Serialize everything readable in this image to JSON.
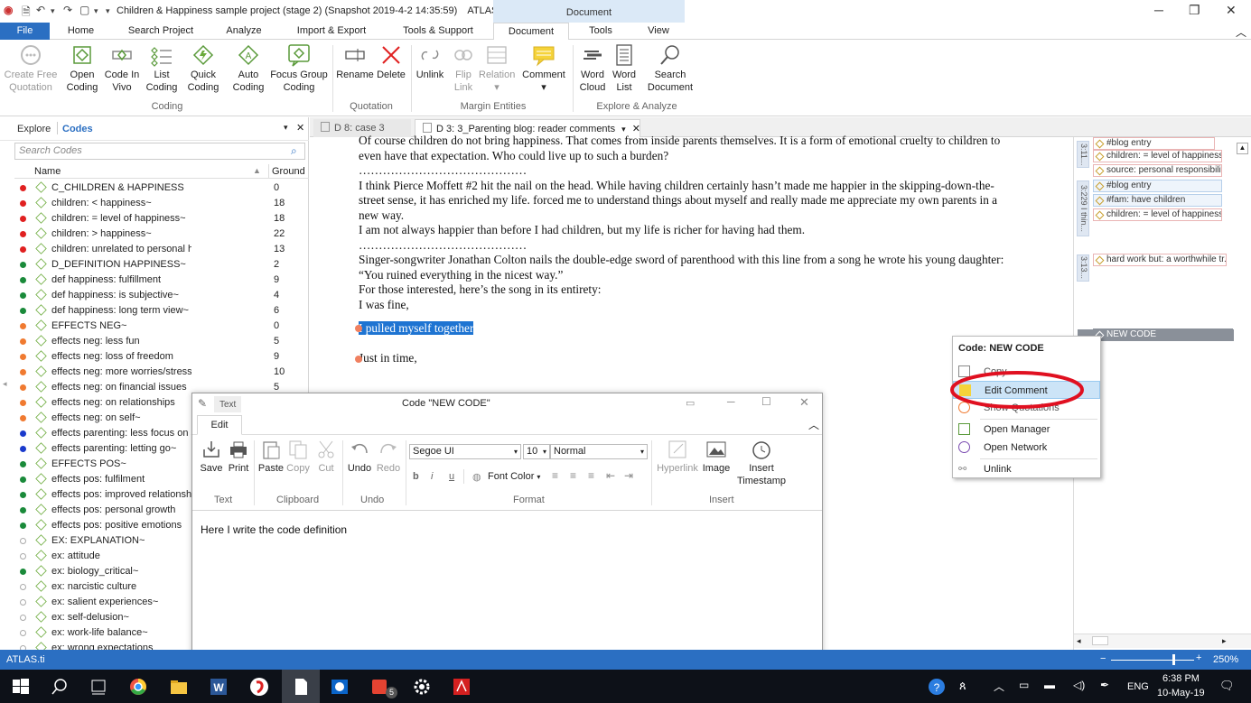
{
  "titlebar": {
    "doc_title": "Children & Happiness sample project (stage 2) (Snapshot 2019-4-2 14:35:59)",
    "app_name": "ATLAS.ti",
    "context_label": "Document"
  },
  "ribbon_tabs": [
    "File",
    "Home",
    "Search Project",
    "Analyze",
    "Import & Export",
    "Tools & Support",
    "Document",
    "Tools",
    "View"
  ],
  "ribbon": {
    "buttons": [
      {
        "l1": "Create Free",
        "l2": "Quotation",
        "disabled": true
      },
      {
        "l1": "Open",
        "l2": "Coding"
      },
      {
        "l1": "Code In",
        "l2": "Vivo"
      },
      {
        "l1": "List",
        "l2": "Coding"
      },
      {
        "l1": "Quick",
        "l2": "Coding"
      },
      {
        "l1": "Auto",
        "l2": "Coding"
      },
      {
        "l1": "Focus Group",
        "l2": "Coding"
      },
      {
        "l1": "Rename",
        "l2": ""
      },
      {
        "l1": "Delete",
        "l2": ""
      },
      {
        "l1": "Unlink",
        "l2": ""
      },
      {
        "l1": "Flip",
        "l2": "Link",
        "disabled": true
      },
      {
        "l1": "Relation",
        "l2": "▾",
        "disabled": true
      },
      {
        "l1": "Comment",
        "l2": "▾"
      },
      {
        "l1": "Word",
        "l2": "Cloud"
      },
      {
        "l1": "Word",
        "l2": "List"
      },
      {
        "l1": "Search",
        "l2": "Document"
      }
    ],
    "groups": [
      "Coding",
      "Quotation",
      "Margin Entities",
      "Explore & Analyze"
    ]
  },
  "left_panel": {
    "tabs": [
      "Explore",
      "Codes"
    ],
    "search_placeholder": "Search Codes",
    "col_name": "Name",
    "col_ground": "Ground",
    "codes": [
      {
        "name": "C_CHILDREN & HAPPINESS",
        "g": "0",
        "c": "#e02020"
      },
      {
        "name": "children: < happiness~",
        "g": "18",
        "c": "#e02020"
      },
      {
        "name": "children: = level of happiness~",
        "g": "18",
        "c": "#e02020"
      },
      {
        "name": "children: > happiness~",
        "g": "22",
        "c": "#e02020"
      },
      {
        "name": "children: unrelated to personal happiness~",
        "g": "13",
        "c": "#e02020"
      },
      {
        "name": "D_DEFINITION HAPPINESS~",
        "g": "2",
        "c": "#1a8a3a"
      },
      {
        "name": "def happiness: fulfillment",
        "g": "9",
        "c": "#1a8a3a"
      },
      {
        "name": "def happiness: is subjective~",
        "g": "4",
        "c": "#1a8a3a"
      },
      {
        "name": "def happiness: long term view~",
        "g": "6",
        "c": "#1a8a3a"
      },
      {
        "name": "EFFECTS NEG~",
        "g": "0",
        "c": "#f07a30"
      },
      {
        "name": "effects neg: less fun",
        "g": "5",
        "c": "#f07a30"
      },
      {
        "name": "effects neg: loss of freedom",
        "g": "9",
        "c": "#f07a30"
      },
      {
        "name": "effects neg: more worries/stress/responsibilities~",
        "g": "10",
        "c": "#f07a30"
      },
      {
        "name": "effects neg: on financial issues",
        "g": "5",
        "c": "#f07a30"
      },
      {
        "name": "effects neg: on relationships",
        "g": "",
        "c": "#f07a30"
      },
      {
        "name": "effects neg: on self~",
        "g": "",
        "c": "#f07a30"
      },
      {
        "name": "effects parenting: less focus on s",
        "g": "",
        "c": "#1a3acc"
      },
      {
        "name": "effects parenting: letting go~",
        "g": "",
        "c": "#1a3acc"
      },
      {
        "name": "EFFECTS POS~",
        "g": "",
        "c": "#1a8a3a"
      },
      {
        "name": "effects pos: fulfilment",
        "g": "",
        "c": "#1a8a3a"
      },
      {
        "name": "effects pos: improved relationshi",
        "g": "",
        "c": "#1a8a3a"
      },
      {
        "name": "effects pos: personal growth",
        "g": "",
        "c": "#1a8a3a"
      },
      {
        "name": "effects pos: positive emotions",
        "g": "",
        "c": "#1a8a3a"
      },
      {
        "name": "EX:  EXPLANATION~",
        "g": "",
        "c": "none"
      },
      {
        "name": "ex: attitude",
        "g": "",
        "c": "none"
      },
      {
        "name": "ex: biology_critical~",
        "g": "",
        "c": "#1a8a3a"
      },
      {
        "name": "ex: narcistic culture",
        "g": "",
        "c": "none"
      },
      {
        "name": "ex: salient experiences~",
        "g": "",
        "c": "none"
      },
      {
        "name": "ex: self-delusion~",
        "g": "",
        "c": "none"
      },
      {
        "name": "ex: work-life balance~",
        "g": "",
        "c": "none"
      },
      {
        "name": "ex: wrong expectations",
        "g": "",
        "c": "none"
      }
    ]
  },
  "doc_tabs": [
    {
      "label": "D 8: case 3"
    },
    {
      "label": "D 3: 3_Parenting blog: reader comments"
    }
  ],
  "document": {
    "lines": [
      "Of course children do not bring happiness. That comes from inside parents themselves. It is a form of emotional cruelty to children to",
      "even have that expectation. Who could live up to such a burden?",
      "……………………………………",
      "I think Pierce Moffett #2 hit the nail on the head. While having children certainly hasn’t made me happier in the skipping-down-the-",
      "street sense, it has enriched my life. forced me to understand things about myself and really made me appreciate my own parents in a",
      "new way.",
      "I am not always happier than before I had children, but my life is richer for having had them.",
      "……………………………………",
      "Singer-songwriter Jonathan Colton nails the double-edge sword of parenthood with this line from a song he wrote his young daughter:",
      "“You ruined everything in the nicest way.”",
      "For those interested, here’s the song in its entirety:",
      "I was fine,"
    ],
    "selected_line": "I pulled myself together",
    "after_line": "Just in time,"
  },
  "margin": {
    "tags": [
      {
        "t": "#blog entry",
        "blue": false
      },
      {
        "t": "children: = level of happiness",
        "blue": false
      },
      {
        "t": "source: personal responsibility",
        "blue": false
      },
      {
        "t": "#blog entry",
        "blue": true
      },
      {
        "t": "#fam: have children",
        "blue": true
      },
      {
        "t": "children: = level of happiness",
        "blue": false
      },
      {
        "t": "hard work but: a worthwhile tr...",
        "blue": false
      },
      {
        "t": "NEW CODE",
        "blue": true
      }
    ],
    "bars": [
      "3:11...",
      "3:229 I thin...",
      "3:13..."
    ]
  },
  "context_menu": {
    "title": "Code: NEW CODE",
    "items": [
      "Copy",
      "Edit Comment",
      "Show Quotations",
      "Open Manager",
      "Open Network",
      "Unlink"
    ]
  },
  "editor": {
    "tab_label": "Text",
    "title": "Code \"NEW CODE\"",
    "ribbon_tab": "Edit",
    "font": "Segoe UI",
    "size": "10",
    "style": "Normal",
    "font_color": "Font Color",
    "buttons": [
      "Save",
      "Print",
      "Paste",
      "Copy",
      "Cut",
      "Undo",
      "Redo",
      "Hyperlink",
      "Image",
      "Insert",
      "Timestamp"
    ],
    "groups": [
      "Text",
      "Clipboard",
      "Undo",
      "Format",
      "Insert"
    ],
    "body": "Here I write the code definition"
  },
  "status": {
    "left": "ATLAS.ti",
    "zoom": "250%"
  },
  "taskbar": {
    "lang": "ENG",
    "time": "6:38 PM",
    "date": "10-May-19",
    "badge": "5"
  },
  "colors": {
    "accent": "#2b6fc2",
    "selection": "#1e74d2",
    "annotation": "#e01020"
  }
}
